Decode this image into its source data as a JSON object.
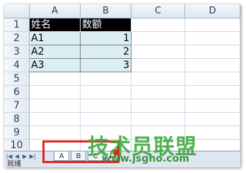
{
  "columns": [
    "A",
    "B",
    "C",
    "D"
  ],
  "rows": [
    "1",
    "2",
    "3",
    "4",
    "5",
    "6",
    "7",
    "8",
    "9",
    "10"
  ],
  "table": {
    "headers": [
      "姓名",
      "数额"
    ],
    "data": [
      [
        "A1",
        "1"
      ],
      [
        "A2",
        "2"
      ],
      [
        "A3",
        "3"
      ]
    ]
  },
  "sheet_tabs": [
    "A",
    "B",
    "C",
    "D"
  ],
  "status": {
    "ready": "就绪"
  },
  "watermark": {
    "title": "技术员联盟",
    "url": "www.jsgho.com"
  },
  "colors": {
    "header_fill": "#000000",
    "data_fill": "#dbeef4",
    "highlight": "#e2231a",
    "watermark": "#3aa838"
  }
}
